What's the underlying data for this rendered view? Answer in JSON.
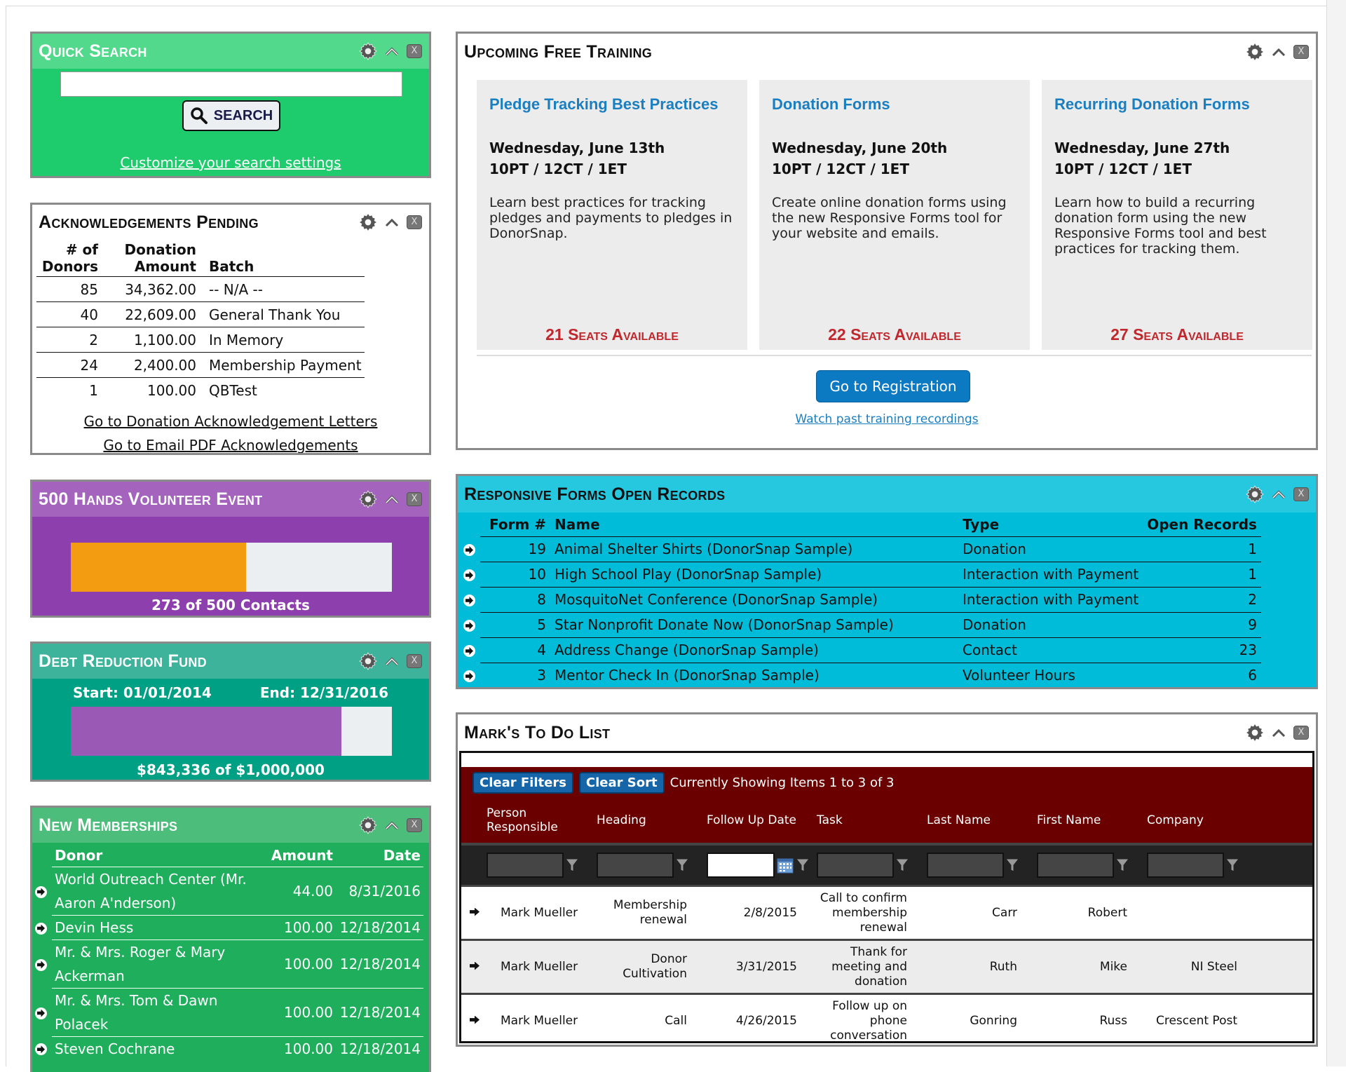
{
  "widgets": {
    "quick_search": {
      "title": "Quick Search",
      "input_value": "",
      "input_placeholder": "",
      "search_button": "SEARCH",
      "customize_link": "Customize your search settings"
    },
    "acknowledgements": {
      "title": "Acknowledgements Pending",
      "headers": {
        "donors_1": "# of",
        "donors_2": "Donors",
        "amount_1": "Donation",
        "amount_2": "Amount",
        "batch": "Batch"
      },
      "rows": [
        {
          "donors": "85",
          "amount": "34,362.00",
          "batch": "-- N/A --"
        },
        {
          "donors": "40",
          "amount": "22,609.00",
          "batch": "General Thank You"
        },
        {
          "donors": "2",
          "amount": "1,100.00",
          "batch": "In Memory"
        },
        {
          "donors": "24",
          "amount": "2,400.00",
          "batch": "Membership Payment"
        },
        {
          "donors": "1",
          "amount": "100.00",
          "batch": "QBTest"
        }
      ],
      "links": [
        "Go to Donation Acknowledgement Letters",
        "Go to Email PDF Acknowledgements"
      ]
    },
    "volunteer_event": {
      "title": "500 Hands Volunteer Event",
      "current": 273,
      "goal": 500,
      "progress_fraction": 0.546,
      "caption": "273 of 500 Contacts",
      "fill_color": "#f39c12"
    },
    "debt_fund": {
      "title": "Debt Reduction Fund",
      "start": "Start: 01/01/2014",
      "end": "End: 12/31/2016",
      "raised": 843336,
      "goal": 1000000,
      "progress_fraction": 0.843,
      "caption": "$843,336 of $1,000,000",
      "fill_color": "#9b59b6"
    },
    "memberships": {
      "title": "New Memberships",
      "headers": {
        "donor": "Donor",
        "amount": "Amount",
        "date": "Date"
      },
      "rows": [
        {
          "donor": "World Outreach Center (Mr. Aaron A'nderson)",
          "amount": "44.00",
          "date": "8/31/2016"
        },
        {
          "donor": "Devin Hess",
          "amount": "100.00",
          "date": "12/18/2014"
        },
        {
          "donor": "Mr. & Mrs. Roger & Mary Ackerman",
          "amount": "100.00",
          "date": "12/18/2014"
        },
        {
          "donor": "Mr. & Mrs. Tom & Dawn Polacek",
          "amount": "100.00",
          "date": "12/18/2014"
        },
        {
          "donor": "Steven Cochrane",
          "amount": "100.00",
          "date": "12/18/2014"
        }
      ]
    },
    "training": {
      "title": "Upcoming Free Training",
      "cards": [
        {
          "title": "Pledge Tracking Best Practices",
          "date": "Wednesday, June 13th",
          "time": "10PT / 12CT / 1ET",
          "desc": "Learn best practices for tracking pledges and payments to pledges in DonorSnap.",
          "seats": "21 Seats Available"
        },
        {
          "title": "Donation Forms",
          "date": "Wednesday, June 20th",
          "time": "10PT / 12CT / 1ET",
          "desc": "Create online donation forms using the new Responsive Forms tool for your website and emails.",
          "seats": "22 Seats Available"
        },
        {
          "title": "Recurring Donation Forms",
          "date": "Wednesday, June 27th",
          "time": "10PT / 12CT / 1ET",
          "desc": "Learn how to build a recurring donation form using the new Responsive Forms tool and best practices for tracking them.",
          "seats": "27 Seats Available"
        }
      ],
      "register_button": "Go to Registration",
      "past_link": "Watch past training recordings"
    },
    "responsive_forms": {
      "title": "Responsive Forms Open Records",
      "headers": {
        "form": "Form #",
        "name": "Name",
        "type": "Type",
        "open": "Open Records"
      },
      "rows": [
        {
          "form": "19",
          "name": "Animal Shelter Shirts (DonorSnap Sample)",
          "type": "Donation",
          "open": "1"
        },
        {
          "form": "10",
          "name": "High School Play (DonorSnap Sample)",
          "type": "Interaction with Payment",
          "open": "1"
        },
        {
          "form": "8",
          "name": "MosquitoNet Conference (DonorSnap Sample)",
          "type": "Interaction with Payment",
          "open": "2"
        },
        {
          "form": "5",
          "name": "Star Nonprofit Donate Now (DonorSnap Sample)",
          "type": "Donation",
          "open": "9"
        },
        {
          "form": "4",
          "name": "Address Change (DonorSnap Sample)",
          "type": "Contact",
          "open": "23"
        },
        {
          "form": "3",
          "name": "Mentor Check In (DonorSnap Sample)",
          "type": "Volunteer Hours",
          "open": "6"
        }
      ]
    },
    "todo": {
      "title": "Mark's To Do List",
      "clear_filters": "Clear Filters",
      "clear_sort": "Clear Sort",
      "status": "Currently Showing Items 1 to 3 of 3",
      "headers": [
        "Person Responsible",
        "Heading",
        "Follow Up Date",
        "Task",
        "Last Name",
        "First Name",
        "Company"
      ],
      "rows": [
        {
          "person": "Mark Mueller",
          "heading": "Membership renewal",
          "date": "2/8/2015",
          "task": "Call to confirm membership renewal",
          "last": "Carr",
          "first": "Robert",
          "company": ""
        },
        {
          "person": "Mark Mueller",
          "heading": "Donor Cultivation",
          "date": "3/31/2015",
          "task": "Thank for meeting and donation",
          "last": "Ruth",
          "first": "Mike",
          "company": "NI Steel"
        },
        {
          "person": "Mark Mueller",
          "heading": "Call",
          "date": "4/26/2015",
          "task": "Follow up on phone conversation",
          "last": "Gonring",
          "first": "Russ",
          "company": "Crescent Post"
        }
      ]
    }
  },
  "icons": {
    "settings": "gear-icon",
    "collapse": "chevron-up-icon",
    "close": "close-icon",
    "search": "search-icon",
    "row_link": "arrow-right-icon",
    "filter": "funnel-icon",
    "calendar": "calendar-icon"
  },
  "close_glyph": "X"
}
